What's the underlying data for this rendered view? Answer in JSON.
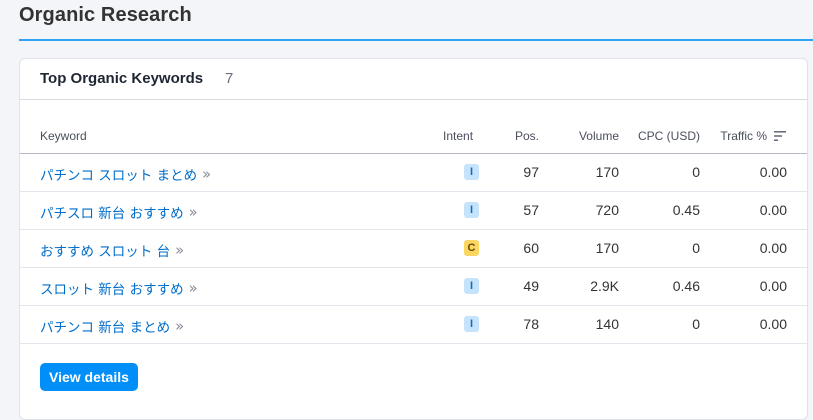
{
  "page": {
    "title": "Organic Research"
  },
  "card": {
    "title": "Top Organic Keywords",
    "count": "7"
  },
  "table": {
    "headers": {
      "keyword": "Keyword",
      "intent": "Intent",
      "pos": "Pos.",
      "volume": "Volume",
      "cpc": "CPC (USD)",
      "traffic": "Traffic %"
    },
    "sort_icon": "sort-descending-icon",
    "link_arrow_icon": "double-chevron-right-icon",
    "rows": [
      {
        "keyword": "パチンコ スロット まとめ",
        "intent": "I",
        "pos": "97",
        "volume": "170",
        "cpc": "0",
        "traffic": "0.00"
      },
      {
        "keyword": "パチスロ 新台 おすすめ",
        "intent": "I",
        "pos": "57",
        "volume": "720",
        "cpc": "0.45",
        "traffic": "0.00"
      },
      {
        "keyword": "おすすめ スロット 台",
        "intent": "C",
        "pos": "60",
        "volume": "170",
        "cpc": "0",
        "traffic": "0.00"
      },
      {
        "keyword": "スロット 新台 おすすめ",
        "intent": "I",
        "pos": "49",
        "volume": "2.9K",
        "cpc": "0.46",
        "traffic": "0.00"
      },
      {
        "keyword": "パチンコ 新台 まとめ",
        "intent": "I",
        "pos": "78",
        "volume": "140",
        "cpc": "0",
        "traffic": "0.00"
      }
    ]
  },
  "actions": {
    "view_details": "View details"
  },
  "colors": {
    "accent": "#008ff8",
    "link": "#006dca",
    "intent_informational_bg": "#c5e4fb",
    "intent_commercial_bg": "#fcd663"
  }
}
